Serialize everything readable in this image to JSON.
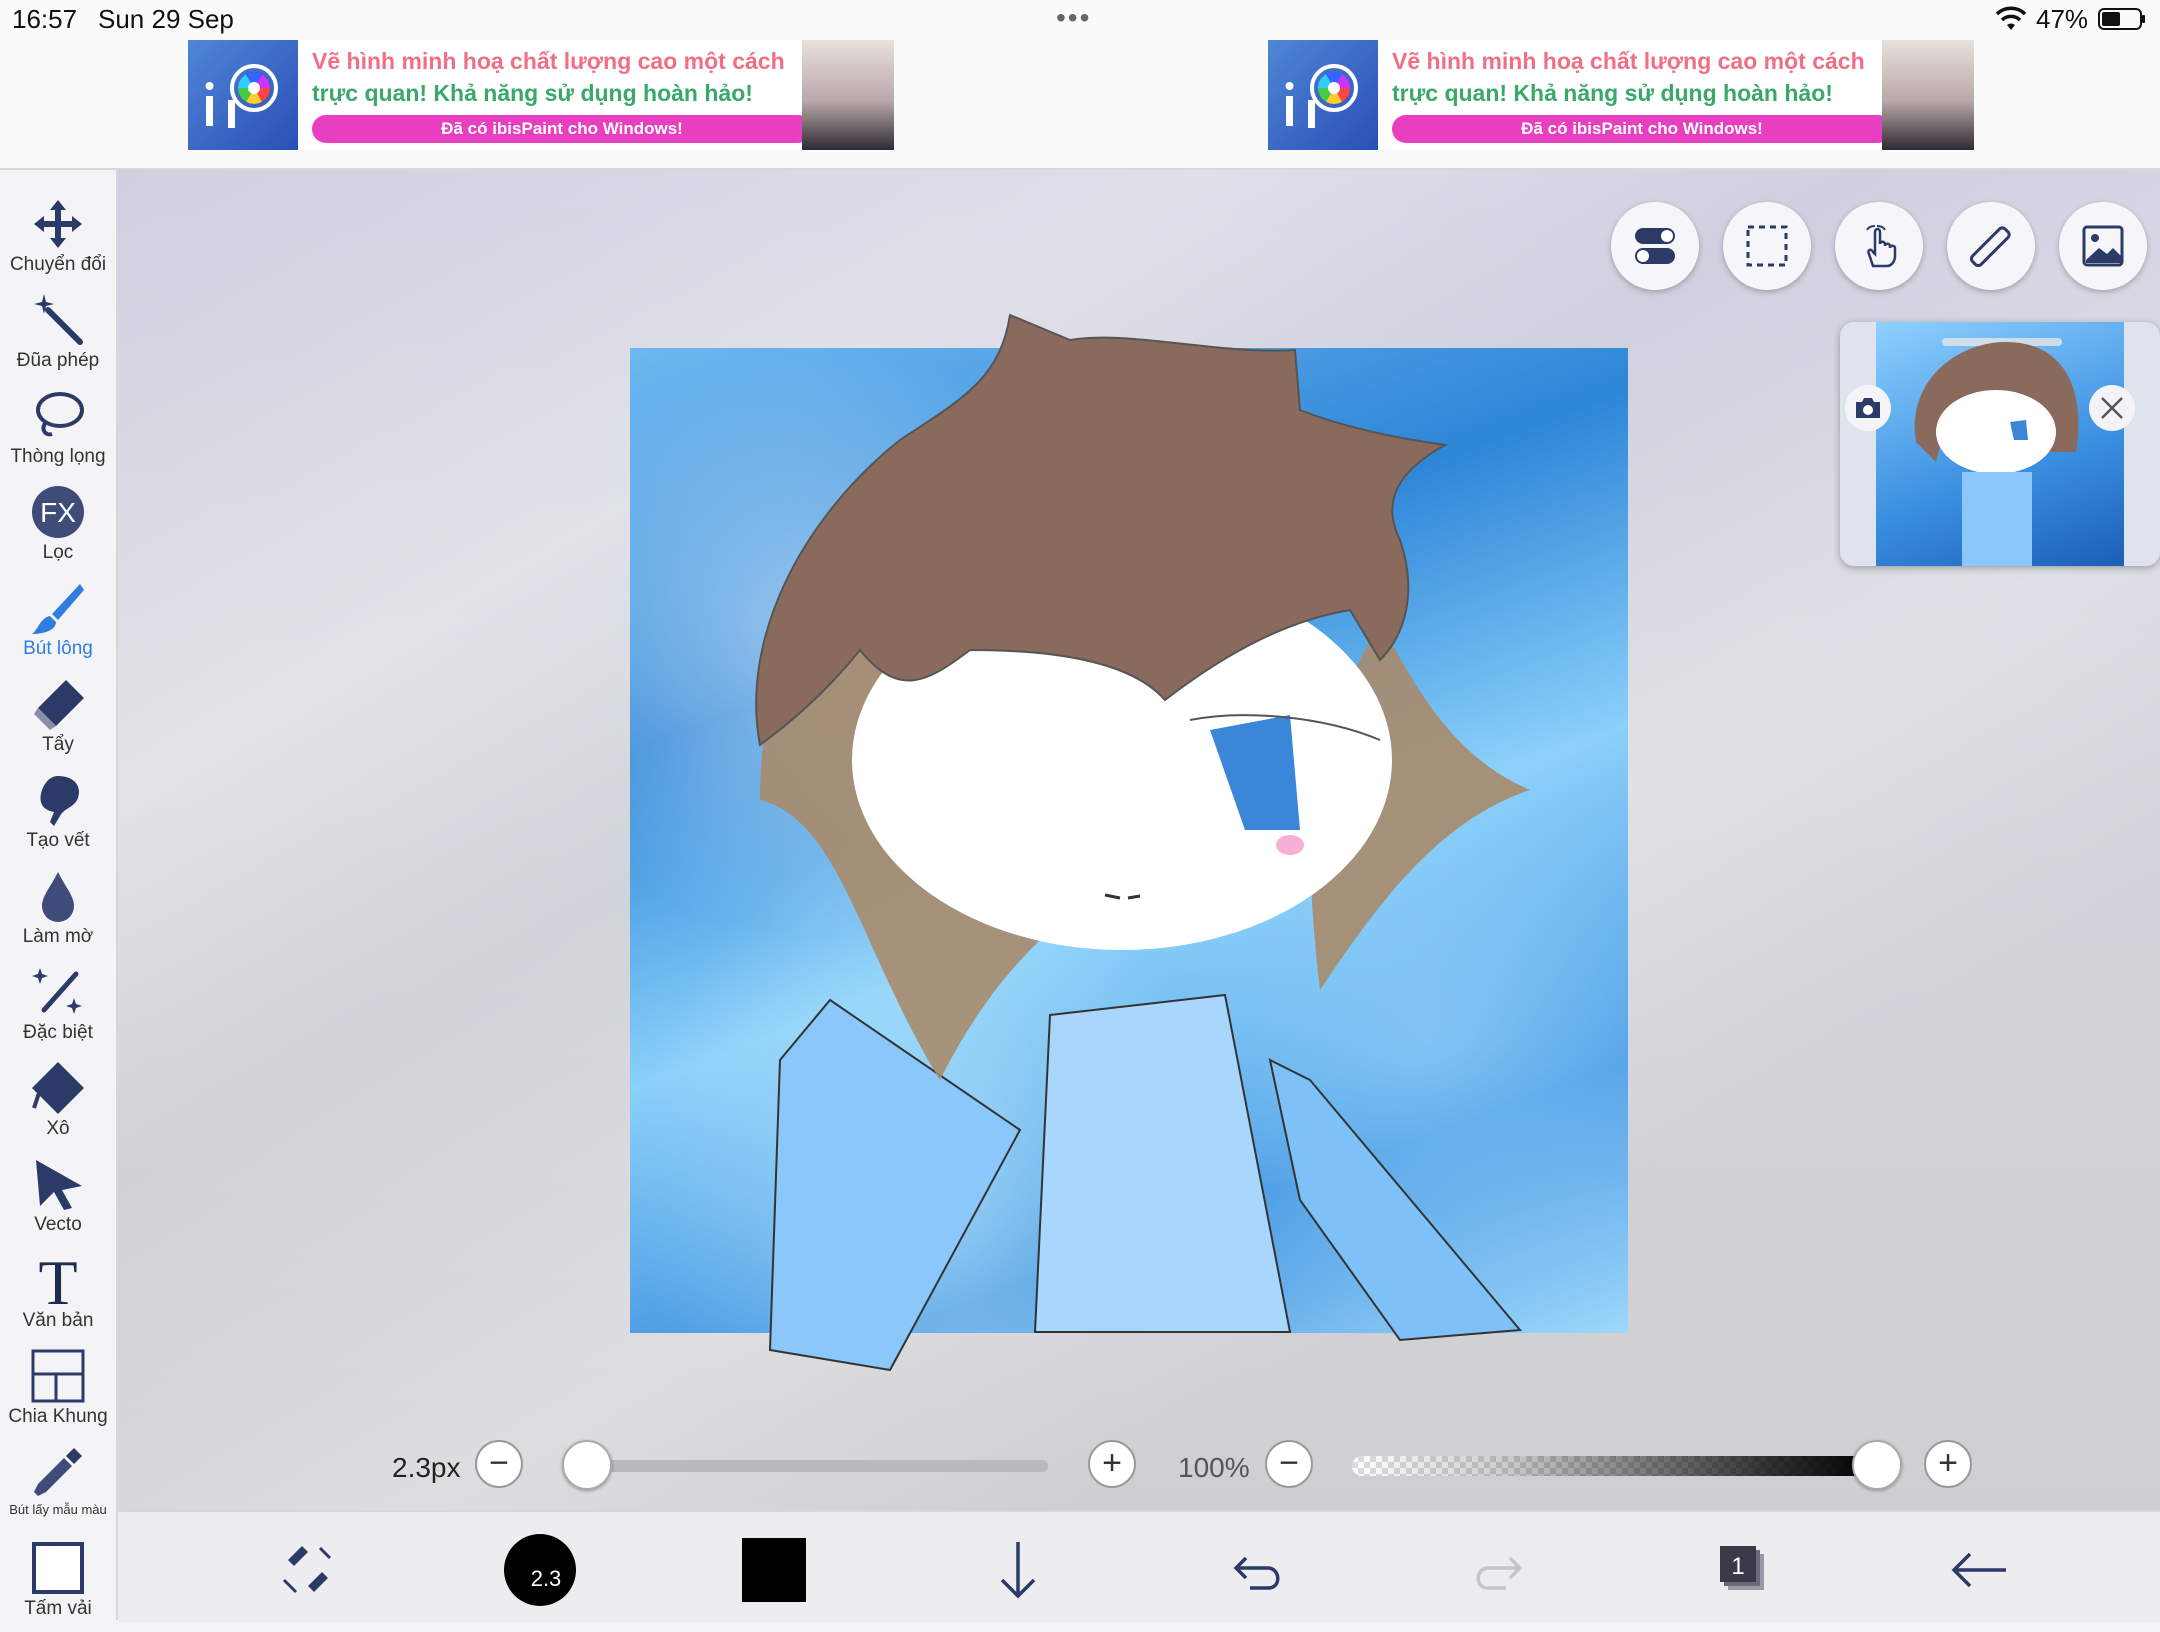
{
  "status": {
    "time": "16:57",
    "date": "Sun 29 Sep",
    "dots": "•••",
    "battery": "47%"
  },
  "ads": [
    {
      "line1": "Vẽ hình minh hoạ chất lượng cao một cách",
      "line2": "trực quan! Khả năng sử dụng hoàn hảo!",
      "pill": "Đã có ibisPaint cho Windows!"
    },
    {
      "line1": "Vẽ hình minh hoạ chất lượng cao một cách",
      "line2": "trực quan! Khả năng sử dụng hoàn hảo!",
      "pill": "Đã có ibisPaint cho Windows!"
    }
  ],
  "tools": [
    {
      "label": "Chuyển đổi",
      "icon": "move-icon"
    },
    {
      "label": "Đũa phép",
      "icon": "magic-wand-icon"
    },
    {
      "label": "Thòng lọng",
      "icon": "lasso-icon"
    },
    {
      "label": "Lọc",
      "icon": "fx-filter-icon"
    },
    {
      "label": "Bút lông",
      "icon": "brush-icon",
      "active": true
    },
    {
      "label": "Tẩy",
      "icon": "eraser-icon"
    },
    {
      "label": "Tạo vết",
      "icon": "smudge-icon"
    },
    {
      "label": "Làm mờ",
      "icon": "blur-drop-icon"
    },
    {
      "label": "Đặc biệt",
      "icon": "special-pen-icon"
    },
    {
      "label": "Xô",
      "icon": "bucket-icon"
    },
    {
      "label": "Vecto",
      "icon": "vector-cursor-icon"
    },
    {
      "label": "Văn bản",
      "icon": "text-icon"
    },
    {
      "label": "Chia Khung",
      "icon": "frame-divider-icon"
    },
    {
      "label": "Bút lấy mẫu màu",
      "icon": "eyedropper-icon"
    },
    {
      "label": "Tấm vải",
      "icon": "canvas-icon"
    }
  ],
  "fx_label": "FX",
  "brush": {
    "size": "2.3px",
    "size_value": 2.3,
    "size_fraction": 0.0,
    "opacity": "100%",
    "opacity_fraction": 1.0,
    "badge": "2.3"
  },
  "colors": {
    "accent": "#2f7de0",
    "current_color": "#000000"
  },
  "layers_count": "1"
}
